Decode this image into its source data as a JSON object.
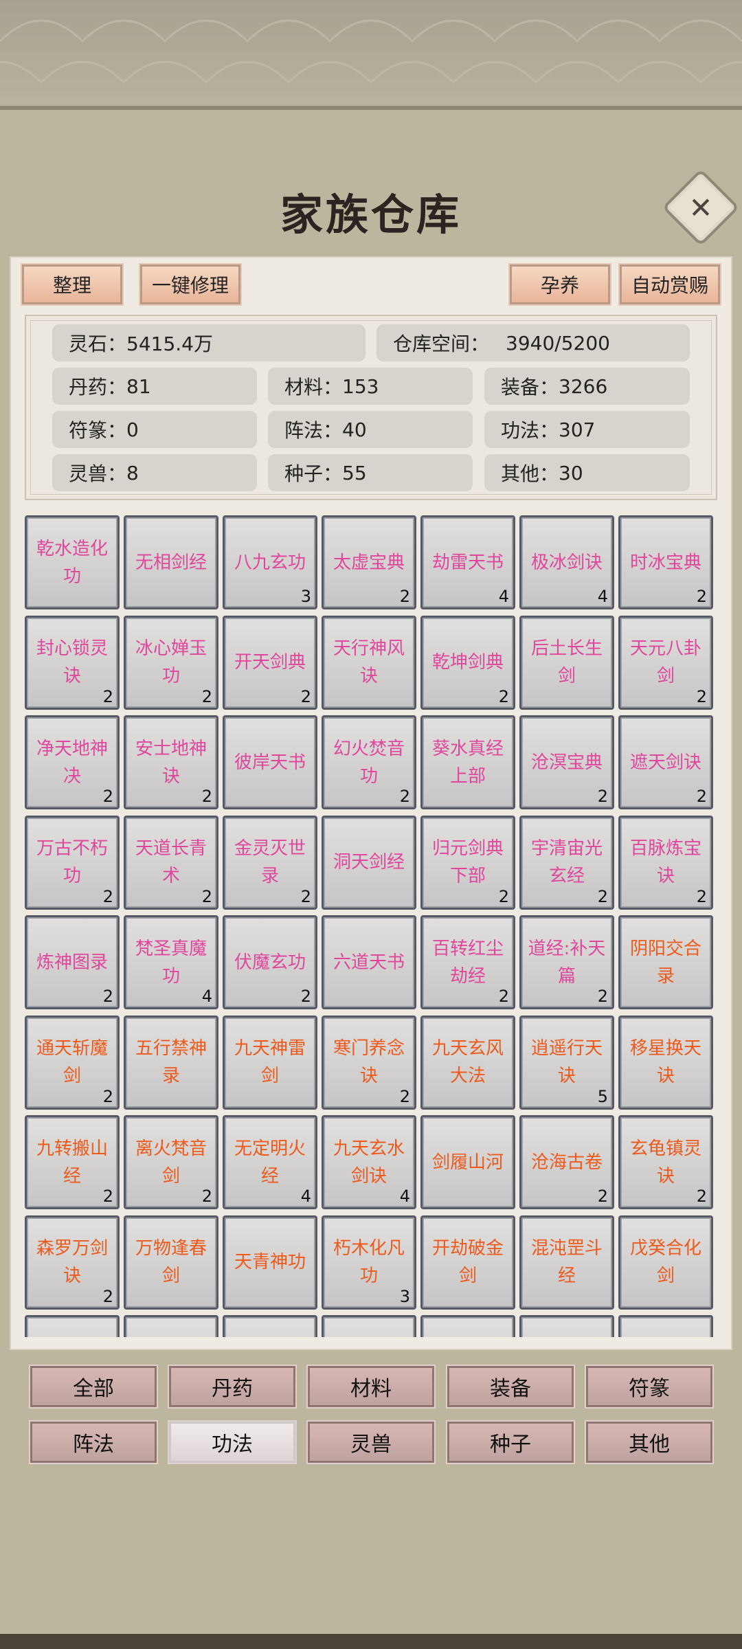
{
  "title": "家族仓库",
  "toolbar": {
    "sort": "整理",
    "repair_all": "一键修理",
    "nurture": "孕养",
    "auto_reward": "自动赏赐"
  },
  "stats": {
    "spirit_stone": {
      "label": "灵石：",
      "value": "5415.4万"
    },
    "storage": {
      "label": "仓库空间：",
      "value": "3940/5200"
    },
    "pills": {
      "label": "丹药：",
      "value": "81"
    },
    "materials": {
      "label": "材料：",
      "value": "153"
    },
    "equipment": {
      "label": "装备：",
      "value": "3266"
    },
    "talismans": {
      "label": "符篆：",
      "value": "0"
    },
    "formations": {
      "label": "阵法：",
      "value": "40"
    },
    "techniques": {
      "label": "功法：",
      "value": "307"
    },
    "beasts": {
      "label": "灵兽：",
      "value": "8"
    },
    "seeds": {
      "label": "种子：",
      "value": "55"
    },
    "others": {
      "label": "其他：",
      "value": "30"
    }
  },
  "items": [
    {
      "name": "乾水造化功",
      "count": "",
      "color": "pink"
    },
    {
      "name": "无相剑经",
      "count": "",
      "color": "pink"
    },
    {
      "name": "八九玄功",
      "count": "3",
      "color": "pink"
    },
    {
      "name": "太虚宝典",
      "count": "2",
      "color": "pink"
    },
    {
      "name": "劫雷天书",
      "count": "4",
      "color": "pink"
    },
    {
      "name": "极冰剑诀",
      "count": "4",
      "color": "pink"
    },
    {
      "name": "时冰宝典",
      "count": "2",
      "color": "pink"
    },
    {
      "name": "封心锁灵诀",
      "count": "2",
      "color": "pink"
    },
    {
      "name": "冰心婵玉功",
      "count": "2",
      "color": "pink"
    },
    {
      "name": "开天剑典",
      "count": "2",
      "color": "pink"
    },
    {
      "name": "天行神风诀",
      "count": "",
      "color": "pink"
    },
    {
      "name": "乾坤剑典",
      "count": "2",
      "color": "pink"
    },
    {
      "name": "后土长生剑",
      "count": "",
      "color": "pink"
    },
    {
      "name": "天元八卦剑",
      "count": "2",
      "color": "pink"
    },
    {
      "name": "净天地神决",
      "count": "2",
      "color": "pink"
    },
    {
      "name": "安士地神诀",
      "count": "2",
      "color": "pink"
    },
    {
      "name": "彼岸天书",
      "count": "",
      "color": "pink"
    },
    {
      "name": "幻火焚音功",
      "count": "2",
      "color": "pink"
    },
    {
      "name": "葵水真经上部",
      "count": "",
      "color": "pink"
    },
    {
      "name": "沧溟宝典",
      "count": "2",
      "color": "pink"
    },
    {
      "name": "遮天剑诀",
      "count": "2",
      "color": "pink"
    },
    {
      "name": "万古不朽功",
      "count": "2",
      "color": "pink"
    },
    {
      "name": "天道长青术",
      "count": "2",
      "color": "pink"
    },
    {
      "name": "金灵灭世录",
      "count": "2",
      "color": "pink"
    },
    {
      "name": "洞天剑经",
      "count": "",
      "color": "pink"
    },
    {
      "name": "归元剑典下部",
      "count": "2",
      "color": "pink"
    },
    {
      "name": "宇清宙光玄经",
      "count": "2",
      "color": "pink"
    },
    {
      "name": "百脉炼宝诀",
      "count": "2",
      "color": "pink"
    },
    {
      "name": "炼神图录",
      "count": "2",
      "color": "pink"
    },
    {
      "name": "梵圣真魔功",
      "count": "4",
      "color": "pink"
    },
    {
      "name": "伏魔玄功",
      "count": "2",
      "color": "pink"
    },
    {
      "name": "六道天书",
      "count": "",
      "color": "pink"
    },
    {
      "name": "百转红尘劫经",
      "count": "2",
      "color": "pink"
    },
    {
      "name": "道经:补天篇",
      "count": "2",
      "color": "pink"
    },
    {
      "name": "阴阳交合录",
      "count": "",
      "color": "orange"
    },
    {
      "name": "通天斩魔剑",
      "count": "2",
      "color": "orange"
    },
    {
      "name": "五行禁神录",
      "count": "",
      "color": "orange"
    },
    {
      "name": "九天神雷剑",
      "count": "",
      "color": "orange"
    },
    {
      "name": "寒门养念诀",
      "count": "2",
      "color": "orange"
    },
    {
      "name": "九天玄风大法",
      "count": "",
      "color": "orange"
    },
    {
      "name": "逍遥行天诀",
      "count": "5",
      "color": "orange"
    },
    {
      "name": "移星换天诀",
      "count": "",
      "color": "orange"
    },
    {
      "name": "九转搬山经",
      "count": "2",
      "color": "orange"
    },
    {
      "name": "离火梵音剑",
      "count": "2",
      "color": "orange"
    },
    {
      "name": "无定明火经",
      "count": "4",
      "color": "orange"
    },
    {
      "name": "九天玄水剑诀",
      "count": "4",
      "color": "orange"
    },
    {
      "name": "剑履山河",
      "count": "",
      "color": "orange"
    },
    {
      "name": "沧海古卷",
      "count": "2",
      "color": "orange"
    },
    {
      "name": "玄龟镇灵诀",
      "count": "2",
      "color": "orange"
    },
    {
      "name": "森罗万剑诀",
      "count": "2",
      "color": "orange"
    },
    {
      "name": "万物逢春剑",
      "count": "",
      "color": "orange"
    },
    {
      "name": "天青神功",
      "count": "",
      "color": "orange"
    },
    {
      "name": "朽木化凡功",
      "count": "3",
      "color": "orange"
    },
    {
      "name": "开劫破金剑",
      "count": "",
      "color": "orange"
    },
    {
      "name": "混沌罡斗经",
      "count": "",
      "color": "orange"
    },
    {
      "name": "戊癸合化剑",
      "count": "",
      "color": "orange"
    }
  ],
  "colors": {
    "pink": "#e0479c",
    "orange": "#ee5a1c"
  },
  "tabs": [
    {
      "label": "全部",
      "active": false
    },
    {
      "label": "丹药",
      "active": false
    },
    {
      "label": "材料",
      "active": false
    },
    {
      "label": "装备",
      "active": false
    },
    {
      "label": "符篆",
      "active": false
    },
    {
      "label": "阵法",
      "active": false
    },
    {
      "label": "功法",
      "active": true
    },
    {
      "label": "灵兽",
      "active": false
    },
    {
      "label": "种子",
      "active": false
    },
    {
      "label": "其他",
      "active": false
    }
  ]
}
